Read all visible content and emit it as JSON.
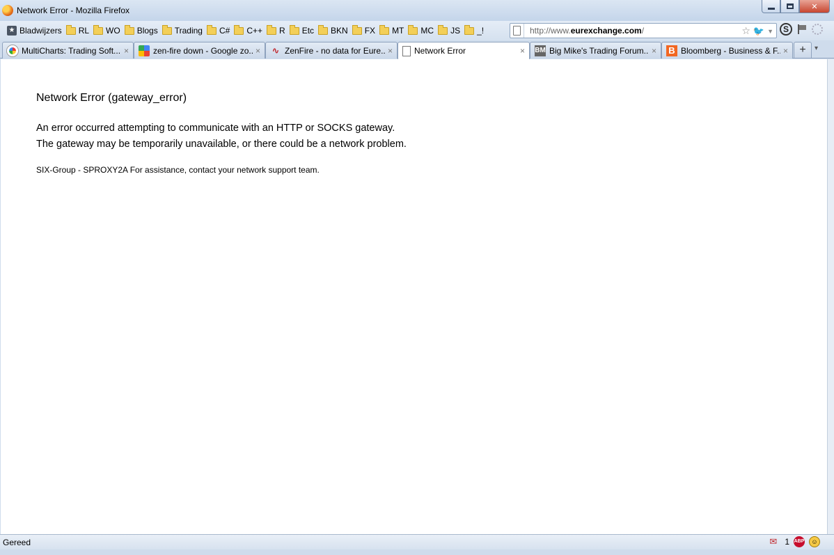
{
  "window": {
    "title": "Network Error - Mozilla Firefox"
  },
  "bookmarks": [
    {
      "label": "Bladwijzers",
      "icon": "bookmarks-icon"
    },
    {
      "label": "RL",
      "icon": "folder-icon"
    },
    {
      "label": "WO",
      "icon": "folder-icon"
    },
    {
      "label": "Blogs",
      "icon": "folder-icon"
    },
    {
      "label": "Trading",
      "icon": "folder-icon"
    },
    {
      "label": "C#",
      "icon": "folder-icon"
    },
    {
      "label": "C++",
      "icon": "folder-icon"
    },
    {
      "label": "R",
      "icon": "folder-icon"
    },
    {
      "label": "Etc",
      "icon": "folder-icon"
    },
    {
      "label": "BKN",
      "icon": "folder-icon"
    },
    {
      "label": "FX",
      "icon": "folder-icon"
    },
    {
      "label": "MT",
      "icon": "folder-icon"
    },
    {
      "label": "MC",
      "icon": "folder-icon"
    },
    {
      "label": "JS",
      "icon": "folder-icon"
    },
    {
      "label": "_!",
      "icon": "folder-icon"
    }
  ],
  "urlbar": {
    "prefix": "http://www.",
    "domain": "eurexchange.com",
    "suffix": "/"
  },
  "tabs": [
    {
      "title": "MultiCharts: Trading Soft...",
      "icon": "multicharts-icon"
    },
    {
      "title": "zen-fire down - Google zo...",
      "icon": "google-icon"
    },
    {
      "title": "ZenFire - no data for Eure...",
      "icon": "zenfire-icon"
    },
    {
      "title": "Network Error",
      "icon": "page-icon",
      "active": true
    },
    {
      "title": "Big Mike's Trading Forum...",
      "icon": "bigmike-icon"
    },
    {
      "title": "Bloomberg - Business & F...",
      "icon": "bloomberg-icon"
    }
  ],
  "content": {
    "title": "Network Error (gateway_error)",
    "line1": "An error occurred attempting to communicate with an HTTP or SOCKS gateway.",
    "line2": "The gateway may be temporarily unavailable, or there could be a network problem.",
    "footer": "SIX-Group - SPROXY2A For assistance, contact your network support team."
  },
  "status": {
    "text": "Gereed",
    "addon_count": "1",
    "abp_label": "ABP"
  },
  "icon_glyphs": {
    "bm": "BM",
    "bloom": "B",
    "zen": "∿",
    "tab_close": "×",
    "new_tab": "+",
    "tab_list": "▾"
  }
}
